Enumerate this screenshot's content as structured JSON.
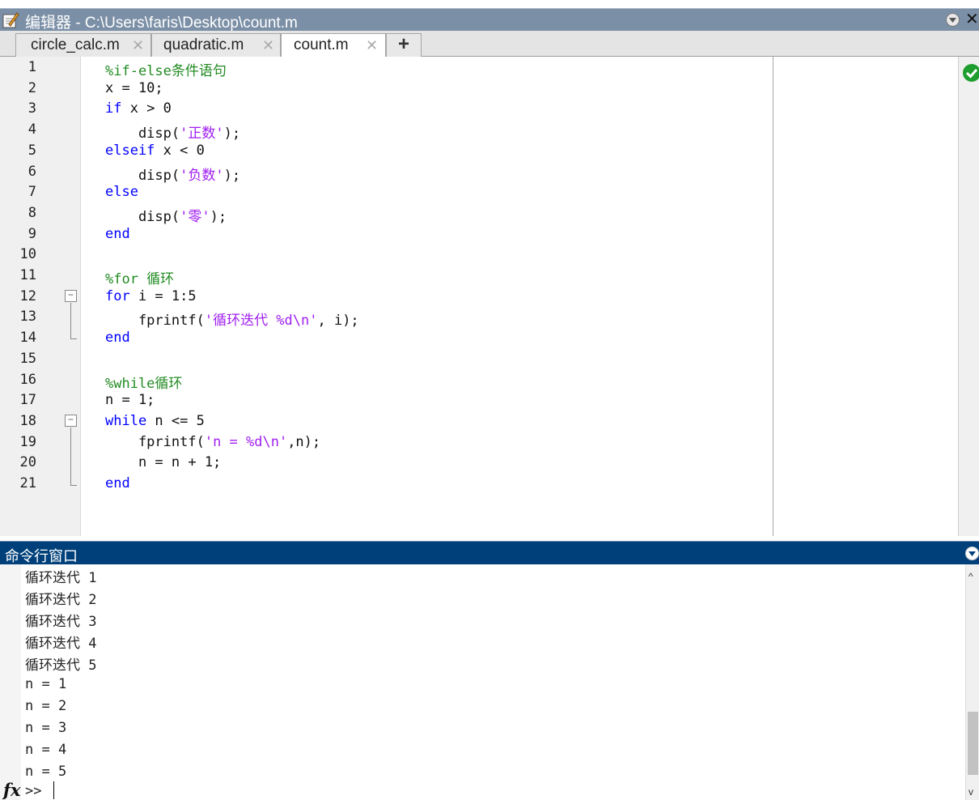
{
  "window": {
    "title": "编辑器 - C:\\Users\\faris\\Desktop\\count.m",
    "close_symbol": "✕",
    "icons": [
      "editor-pencil-icon",
      "window-menu-icon",
      "close-icon"
    ]
  },
  "tabs": [
    {
      "label": "circle_calc.m",
      "close": "✕",
      "active": false
    },
    {
      "label": "quadratic.m",
      "close": "✕",
      "active": false
    },
    {
      "label": "count.m",
      "close": "✕",
      "active": true
    }
  ],
  "add_tab_label": "+",
  "editor": {
    "line_numbers": [
      "1",
      "2",
      "3",
      "4",
      "5",
      "6",
      "7",
      "8",
      "9",
      "10",
      "11",
      "12",
      "13",
      "14",
      "15",
      "16",
      "17",
      "18",
      "19",
      "20",
      "21"
    ],
    "fold_markers": [
      "−",
      "−"
    ],
    "code_analyzer_status": "check-icon",
    "colors": {
      "keyword": "#0000ff",
      "comment": "#228b22",
      "string": "#a020f0"
    },
    "lines": [
      [
        {
          "t": "%if-else条件语句",
          "c": "cm"
        }
      ],
      [
        {
          "t": "x = 10;",
          "c": ""
        }
      ],
      [
        {
          "t": "if",
          "c": "kw"
        },
        {
          "t": " x > 0",
          "c": ""
        }
      ],
      [
        {
          "t": "    disp(",
          "c": ""
        },
        {
          "t": "'正数'",
          "c": "st"
        },
        {
          "t": ");",
          "c": ""
        }
      ],
      [
        {
          "t": "elseif",
          "c": "kw"
        },
        {
          "t": " x < 0",
          "c": ""
        }
      ],
      [
        {
          "t": "    disp(",
          "c": ""
        },
        {
          "t": "'负数'",
          "c": "st"
        },
        {
          "t": ");",
          "c": ""
        }
      ],
      [
        {
          "t": "else",
          "c": "kw"
        }
      ],
      [
        {
          "t": "    disp(",
          "c": ""
        },
        {
          "t": "'零'",
          "c": "st"
        },
        {
          "t": ");",
          "c": ""
        }
      ],
      [
        {
          "t": "end",
          "c": "kw"
        }
      ],
      [],
      [
        {
          "t": "%for 循环",
          "c": "cm"
        }
      ],
      [
        {
          "t": "for",
          "c": "kw"
        },
        {
          "t": " i = 1:5",
          "c": ""
        }
      ],
      [
        {
          "t": "    fprintf(",
          "c": ""
        },
        {
          "t": "'循环迭代 %d\\n'",
          "c": "st"
        },
        {
          "t": ", i);",
          "c": ""
        }
      ],
      [
        {
          "t": "end",
          "c": "kw"
        }
      ],
      [],
      [
        {
          "t": "%while循环",
          "c": "cm"
        }
      ],
      [
        {
          "t": "n = 1;",
          "c": ""
        }
      ],
      [
        {
          "t": "while",
          "c": "kw"
        },
        {
          "t": " n <= 5",
          "c": ""
        }
      ],
      [
        {
          "t": "    fprintf(",
          "c": ""
        },
        {
          "t": "'n = %d\\n'",
          "c": "st"
        },
        {
          "t": ",n);",
          "c": ""
        }
      ],
      [
        {
          "t": "    n = n + 1;",
          "c": ""
        }
      ],
      [
        {
          "t": "end",
          "c": "kw"
        }
      ]
    ]
  },
  "command_window": {
    "title": "命令行窗口",
    "output": [
      "循环迭代 1",
      "循环迭代 2",
      "循环迭代 3",
      "循环迭代 4",
      "循环迭代 5",
      "n = 1",
      "n = 2",
      "n = 3",
      "n = 4",
      "n = 5"
    ],
    "fx_label": "fx",
    "prompt": ">>",
    "scroll_up": "^",
    "scroll_down": "v"
  }
}
